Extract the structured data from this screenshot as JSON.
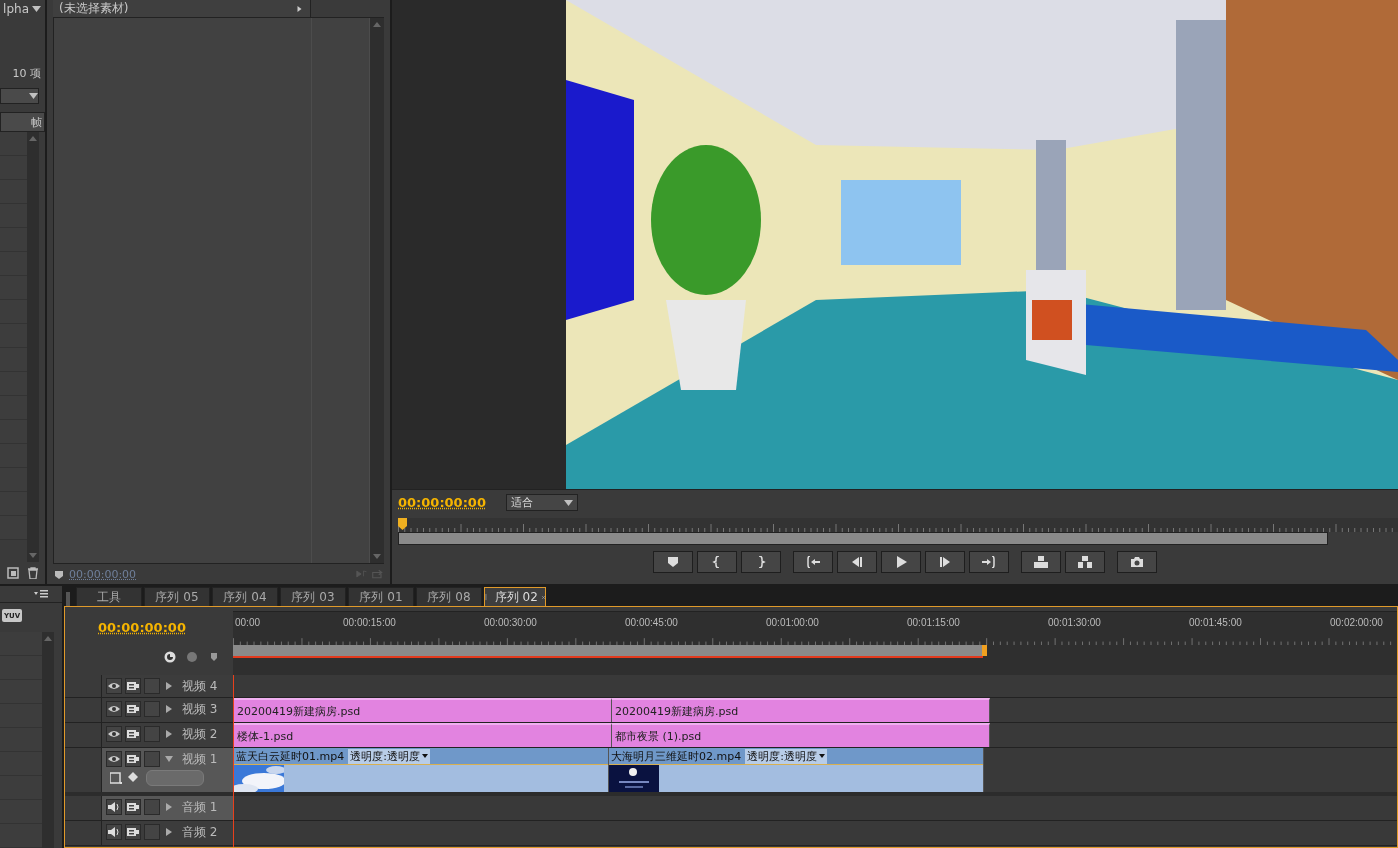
{
  "project_panel": {
    "menu_label": "lpha",
    "item_count": "10 项",
    "column_header": "帧"
  },
  "source_monitor": {
    "title": "(未选择素材)",
    "timecode": "00:00:00:00"
  },
  "program_monitor": {
    "timecode": "00:00:00:00",
    "zoom": "适合"
  },
  "tools_panel": {
    "badge": "YUV"
  },
  "timeline": {
    "tabs": [
      {
        "label": "工具",
        "selected": false
      },
      {
        "label": "序列 05",
        "selected": false
      },
      {
        "label": "序列 04",
        "selected": false
      },
      {
        "label": "序列 03",
        "selected": false
      },
      {
        "label": "序列 01",
        "selected": false
      },
      {
        "label": "序列 08",
        "selected": false
      },
      {
        "label": "序列 02",
        "selected": true
      }
    ],
    "timecode": "00:00:00:00",
    "ruler_labels": [
      "00:00",
      "00:00:15:00",
      "00:00:30:00",
      "00:00:45:00",
      "00:01:00:00",
      "00:01:15:00",
      "00:01:30:00",
      "00:01:45:00",
      "00:02:00:00"
    ],
    "tracks": [
      {
        "name": "视频 4",
        "kind": "video",
        "targeted": false,
        "expanded": false
      },
      {
        "name": "视频 3",
        "kind": "video",
        "targeted": false,
        "expanded": false,
        "clips": [
          {
            "name": "20200419新建病房.psd",
            "kind": "still"
          },
          {
            "name": "20200419新建病房.psd",
            "kind": "still"
          }
        ]
      },
      {
        "name": "视频 2",
        "kind": "video",
        "targeted": false,
        "expanded": false,
        "clips": [
          {
            "name": "楼体-1.psd",
            "kind": "still"
          },
          {
            "name": "都市夜景 (1).psd",
            "kind": "still"
          }
        ]
      },
      {
        "name": "视频 1",
        "kind": "video",
        "targeted": true,
        "expanded": true,
        "clips": [
          {
            "name": "蓝天白云延时01.mp4",
            "kind": "movie",
            "effect": "透明度:透明度"
          },
          {
            "name": "大海明月三维延时02.mp4",
            "kind": "movie",
            "effect": "透明度:透明度"
          }
        ]
      },
      {
        "name": "音频 1",
        "kind": "audio",
        "targeted": true,
        "expanded": false
      },
      {
        "name": "音频 2",
        "kind": "audio",
        "targeted": false,
        "expanded": false
      }
    ]
  }
}
